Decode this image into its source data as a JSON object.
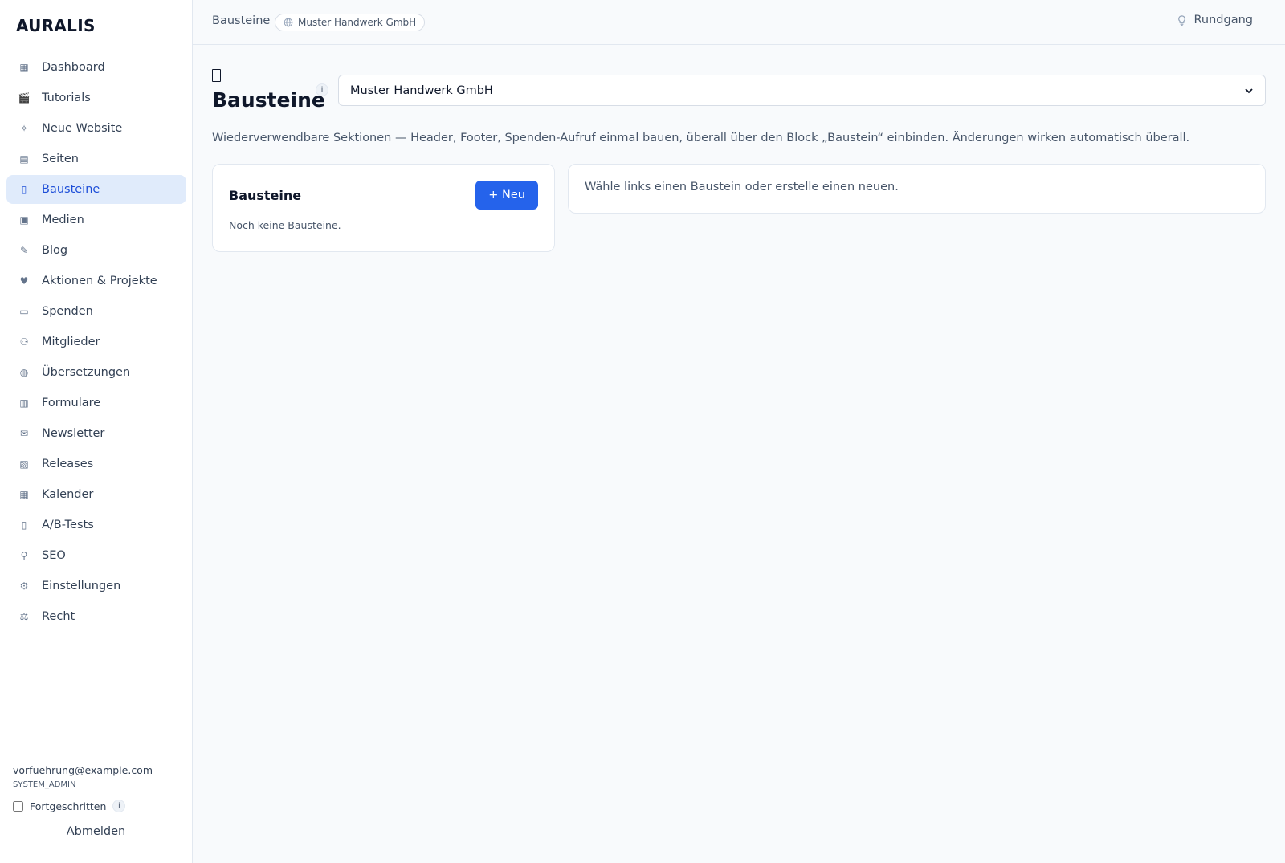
{
  "app": {
    "logo": "AURALIS"
  },
  "sidebar": {
    "items": [
      {
        "label": "Dashboard",
        "icon": "dashboard-icon",
        "active": false
      },
      {
        "label": "Tutorials",
        "icon": "clapperboard-icon",
        "active": false
      },
      {
        "label": "Neue Website",
        "icon": "sparkle-icon",
        "active": false
      },
      {
        "label": "Seiten",
        "icon": "page-icon",
        "active": false
      },
      {
        "label": "Bausteine",
        "icon": "block-icon",
        "active": true
      },
      {
        "label": "Medien",
        "icon": "image-icon",
        "active": false
      },
      {
        "label": "Blog",
        "icon": "pen-icon",
        "active": false
      },
      {
        "label": "Aktionen & Projekte",
        "icon": "heart-icon",
        "active": false
      },
      {
        "label": "Spenden",
        "icon": "card-icon",
        "active": false
      },
      {
        "label": "Mitglieder",
        "icon": "members-icon",
        "active": false
      },
      {
        "label": "Übersetzungen",
        "icon": "globe-icon",
        "active": false
      },
      {
        "label": "Formulare",
        "icon": "inbox-icon",
        "active": false
      },
      {
        "label": "Newsletter",
        "icon": "envelope-icon",
        "active": false
      },
      {
        "label": "Releases",
        "icon": "package-icon",
        "active": false
      },
      {
        "label": "Kalender",
        "icon": "calendar-icon",
        "active": false
      },
      {
        "label": "A/B-Tests",
        "icon": "split-icon",
        "active": false
      },
      {
        "label": "SEO",
        "icon": "magnifier-icon",
        "active": false
      },
      {
        "label": "Einstellungen",
        "icon": "gear-icon",
        "active": false
      },
      {
        "label": "Recht",
        "icon": "scales-icon",
        "active": false
      }
    ],
    "footer": {
      "email": "vorfuehrung@example.com",
      "role": "SYSTEM_ADMIN",
      "advanced_label": "Fortgeschritten",
      "advanced_checked": false,
      "info": "i",
      "logout_label": "Abmelden"
    }
  },
  "topbar": {
    "breadcrumb": "Bausteine",
    "site_pill": "Muster Handwerk GmbH",
    "tour_label": "Rundgang"
  },
  "main": {
    "title": "Bausteine",
    "title_info": "i",
    "site_select": {
      "value": "Muster Handwerk GmbH"
    },
    "description": "Wiederverwendbare Sektionen — Header, Footer, Spenden-Aufruf einmal bauen, überall über den Block „Baustein“ einbinden. Änderungen wirken automatisch überall.",
    "list_card": {
      "title": "Bausteine",
      "new_button": "+ Neu",
      "empty_text": "Noch keine Bausteine."
    },
    "detail_card": {
      "hint": "Wähle links einen Baustein oder erstelle einen neuen."
    }
  },
  "colors": {
    "accent": "#2563eb",
    "active_bg": "#e0ebfb",
    "active_text": "#1d4ed8",
    "background": "#f8fafc"
  }
}
